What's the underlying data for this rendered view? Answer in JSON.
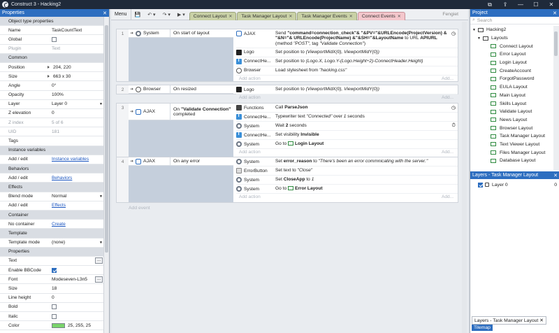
{
  "window": {
    "title": "Construct 3 - Hacking2"
  },
  "properties": {
    "title": "Properties",
    "rows": [
      {
        "type": "section",
        "label": "Object type properties"
      },
      {
        "label": "Name",
        "value": "TaskCountText"
      },
      {
        "label": "Global",
        "checkbox": false
      },
      {
        "label": "Plugin",
        "value": "Text",
        "dim": true
      },
      {
        "type": "section",
        "label": "Common"
      },
      {
        "label": "Position",
        "value": "204, 220",
        "expand": true
      },
      {
        "label": "Size",
        "value": "663 x 30",
        "expand": true
      },
      {
        "label": "Angle",
        "value": "0°"
      },
      {
        "label": "Opacity",
        "value": "100%"
      },
      {
        "label": "Layer",
        "value": "Layer 0",
        "dropdown": true
      },
      {
        "label": "Z elevation",
        "value": "0"
      },
      {
        "label": "Z index",
        "value": "5 of 6",
        "dim": true
      },
      {
        "label": "UID",
        "value": "181",
        "dim": true
      },
      {
        "label": "Tags",
        "value": ""
      },
      {
        "type": "section",
        "label": "Instance variables"
      },
      {
        "label": "Add / edit",
        "value": "Instance variables",
        "link": true
      },
      {
        "type": "section",
        "label": "Behaviors"
      },
      {
        "label": "Add / edit",
        "value": "Behaviors",
        "link": true
      },
      {
        "type": "section",
        "label": "Effects"
      },
      {
        "label": "Blend mode",
        "value": "Normal",
        "dropdown": true
      },
      {
        "label": "Add / edit",
        "value": "Effects",
        "link": true
      },
      {
        "type": "section",
        "label": "Container"
      },
      {
        "label": "No container",
        "value": "Create",
        "link": true
      },
      {
        "type": "section",
        "label": "Template"
      },
      {
        "label": "Template mode",
        "value": "(none)",
        "dropdown": true
      },
      {
        "type": "section",
        "label": "Properties"
      },
      {
        "label": "Text",
        "value": "",
        "dots": true
      },
      {
        "label": "Enable BBCode",
        "checkbox": true
      },
      {
        "label": "Font",
        "value": "Modeseven-L3n5",
        "dots": true
      },
      {
        "label": "Size",
        "value": "18"
      },
      {
        "label": "Line height",
        "value": "0"
      },
      {
        "label": "Bold",
        "checkbox": false
      },
      {
        "label": "Italic",
        "checkbox": false
      },
      {
        "label": "Color",
        "value": "25, 255, 25",
        "swatch": "#7ad46b"
      }
    ]
  },
  "toolbar": {
    "menu_label": "Menu",
    "tabs": [
      {
        "label": "Connect Layout",
        "active": false
      },
      {
        "label": "Task Manager Layout",
        "active": false
      },
      {
        "label": "Task Manager Events",
        "active": false
      },
      {
        "label": "Connect Events",
        "active": true
      }
    ],
    "user": "Fengiet"
  },
  "events": [
    {
      "num": "1",
      "conditions": [
        {
          "object": "System",
          "icon": "sys",
          "text": "On start of layout"
        }
      ],
      "actions": [
        {
          "object": "AJAX",
          "icon": "ajax",
          "html": "Send <b>\"command=connection_check\"& \"&PV=\"&URLEncode(ProjectVersion) & \"&N=\"& URLEncode(ProjectName) &\"&SH=\"&LayoutName</b> to URL <b>APIURL</b> (method <i>\"POST\"</i>, tag <i>\"Validate Connection\"</i>)",
          "mark": "clock"
        },
        {
          "object": "Logo",
          "icon": "sprite",
          "html": "Set position to <i>(ViewportMidX(0), ViewportMidY(0))</i>"
        },
        {
          "object": "ConnectHe...",
          "icon": "text",
          "html": "Set position to <i>(Logo.X, Logo.Y-(Logo.Height÷2)-ConnectHeader.Height)</i>"
        },
        {
          "object": "Browser",
          "icon": "browser",
          "html": "Load stylesheet from <i>\"hacking.css\"</i>"
        }
      ]
    },
    {
      "num": "2",
      "conditions": [
        {
          "object": "Browser",
          "icon": "browser",
          "text": "On resized"
        }
      ],
      "actions": [
        {
          "object": "Logo",
          "icon": "sprite",
          "html": "Set position to <i>(ViewportMidX(0), ViewportMidY(0))</i>"
        }
      ]
    },
    {
      "num": "3",
      "conditions": [
        {
          "object": "AJAX",
          "icon": "ajax",
          "html": "On <b>\"Validate Connection\"</b> completed"
        }
      ],
      "actions": [
        {
          "object": "Functions",
          "icon": "func",
          "html": "Call <b>ParseJson</b>",
          "mark": "clock"
        },
        {
          "object": "ConnectHe...",
          "icon": "text",
          "html": "Typewriter text <i>\"Connected\"</i> over <i>1</i> seconds"
        },
        {
          "object": "System",
          "icon": "sys",
          "html": "Wait <b>2</b> seconds",
          "mark": "timer"
        },
        {
          "object": "ConnectHe...",
          "icon": "text",
          "html": "Set visibility <b>Invisible</b>"
        },
        {
          "object": "System",
          "icon": "sys",
          "html": "Go to <span class=\"lyt\"></span><b>Login Layout</b>"
        }
      ]
    },
    {
      "num": "4",
      "conditions": [
        {
          "object": "AJAX",
          "icon": "ajax",
          "text": "On any error"
        }
      ],
      "actions": [
        {
          "object": "System",
          "icon": "sys",
          "html": "Set <b>error_reason</b> to <i>\"There's been an error commnicating with the server.\"</i>"
        },
        {
          "object": "ErrorButton",
          "icon": "btn",
          "html": "Set text to <i>\"Close\"</i>"
        },
        {
          "object": "System",
          "icon": "sys",
          "html": "Set <b>CloseApp</b> to <i>1</i>"
        },
        {
          "object": "System",
          "icon": "sys",
          "html": "Go to <span class=\"lyt\"></span><b>Error Layout</b>"
        }
      ]
    }
  ],
  "sheet": {
    "add_action": "Add action",
    "add_event": "Add event",
    "add_more": "Add..."
  },
  "project": {
    "title": "Project",
    "search_placeholder": "Search",
    "root": "Hacking2",
    "folder": "Layouts",
    "layouts": [
      "Connect Layout",
      "Error Layout",
      "Login Layout",
      "CreateAccount",
      "ForgotPassword",
      "EULA Layout",
      "Main Layout",
      "Skills Layout",
      "Validate Layout",
      "News Layout",
      "Browser Layout",
      "Task Manager Layout",
      "Text Viewer Layout",
      "Files Manager Layout",
      "Database Layout"
    ]
  },
  "layers": {
    "title": "Layers - Task Manager Layout",
    "rows": [
      {
        "name": "Layer 0",
        "count": "0"
      }
    ],
    "bottom_tabs": [
      "Layers - Task Manager Layout",
      "Tilemap"
    ]
  }
}
